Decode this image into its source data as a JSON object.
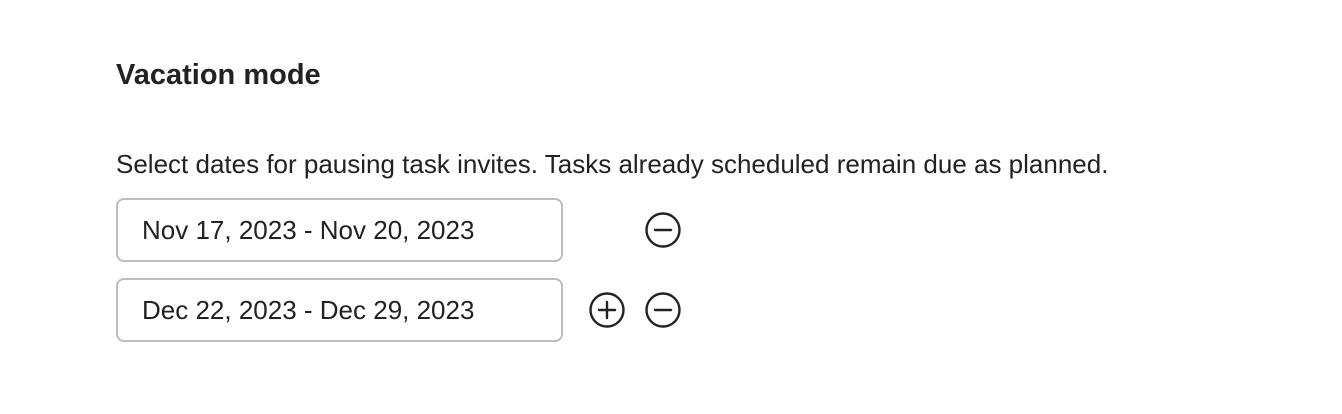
{
  "vacation": {
    "title": "Vacation mode",
    "description": "Select dates for pausing task invites. Tasks already scheduled remain due as planned.",
    "ranges": [
      {
        "value": "Nov 17, 2023 - Nov 20, 2023"
      },
      {
        "value": "Dec 22, 2023 - Dec 29, 2023"
      }
    ]
  },
  "icons": {
    "add": "plus-circle-icon",
    "remove": "minus-circle-icon"
  },
  "colors": {
    "text": "#222222",
    "field_border": "#bdbdbd",
    "icon": "#222222"
  }
}
